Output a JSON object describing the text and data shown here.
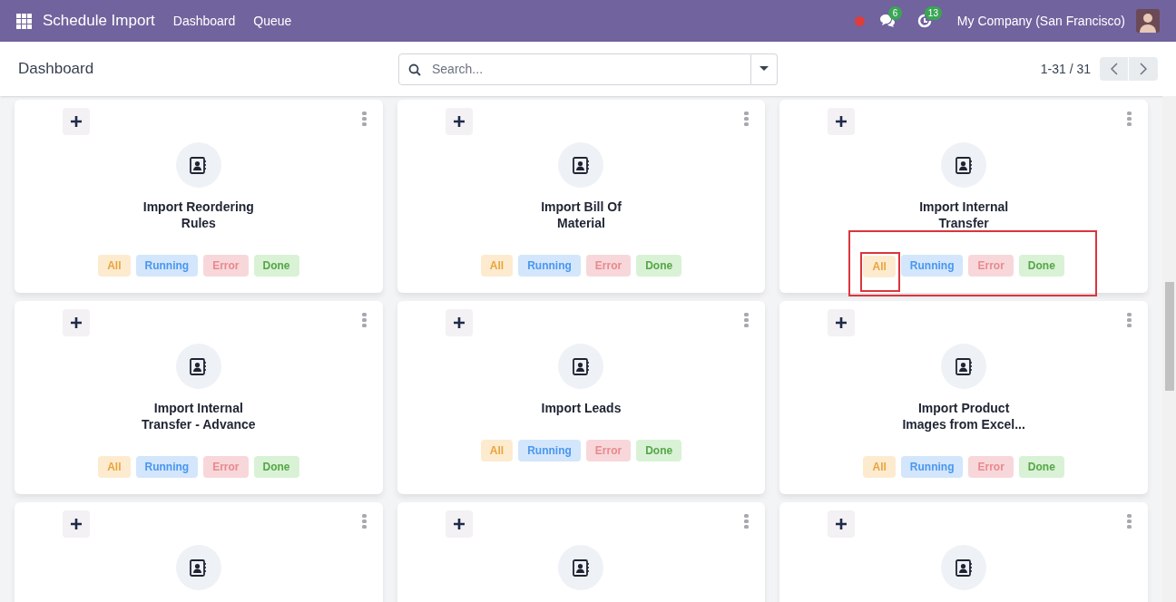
{
  "navbar": {
    "app_title": "Schedule Import",
    "menu": [
      {
        "label": "Dashboard"
      },
      {
        "label": "Queue"
      }
    ],
    "messages_count": "6",
    "activities_count": "13",
    "company": "My Company (San Francisco)"
  },
  "control_panel": {
    "breadcrumb": "Dashboard",
    "search": {
      "placeholder": "Search..."
    },
    "pager": "1-31 / 31"
  },
  "cards": [
    {
      "title": "Import Reordering Rules",
      "highlighted": false,
      "filters": [
        {
          "label": "All",
          "kind": "all",
          "highlighted": false
        },
        {
          "label": "Running",
          "kind": "running",
          "highlighted": false
        },
        {
          "label": "Error",
          "kind": "error",
          "highlighted": false
        },
        {
          "label": "Done",
          "kind": "done",
          "highlighted": false
        }
      ]
    },
    {
      "title": "Import Bill Of Material",
      "highlighted": false,
      "filters": [
        {
          "label": "All",
          "kind": "all",
          "highlighted": false
        },
        {
          "label": "Running",
          "kind": "running",
          "highlighted": false
        },
        {
          "label": "Error",
          "kind": "error",
          "highlighted": false
        },
        {
          "label": "Done",
          "kind": "done",
          "highlighted": false
        }
      ]
    },
    {
      "title": "Import Internal Transfer",
      "highlighted": true,
      "filters": [
        {
          "label": "All",
          "kind": "all",
          "highlighted": true
        },
        {
          "label": "Running",
          "kind": "running",
          "highlighted": false
        },
        {
          "label": "Error",
          "kind": "error",
          "highlighted": false
        },
        {
          "label": "Done",
          "kind": "done",
          "highlighted": false
        }
      ]
    },
    {
      "title": "Import Internal Transfer - Advance",
      "highlighted": false,
      "filters": [
        {
          "label": "All",
          "kind": "all",
          "highlighted": false
        },
        {
          "label": "Running",
          "kind": "running",
          "highlighted": false
        },
        {
          "label": "Error",
          "kind": "error",
          "highlighted": false
        },
        {
          "label": "Done",
          "kind": "done",
          "highlighted": false
        }
      ]
    },
    {
      "title": "Import Leads",
      "highlighted": false,
      "filters": [
        {
          "label": "All",
          "kind": "all",
          "highlighted": false
        },
        {
          "label": "Running",
          "kind": "running",
          "highlighted": false
        },
        {
          "label": "Error",
          "kind": "error",
          "highlighted": false
        },
        {
          "label": "Done",
          "kind": "done",
          "highlighted": false
        }
      ]
    },
    {
      "title": "Import Product Images from Excel...",
      "highlighted": false,
      "filters": [
        {
          "label": "All",
          "kind": "all",
          "highlighted": false
        },
        {
          "label": "Running",
          "kind": "running",
          "highlighted": false
        },
        {
          "label": "Error",
          "kind": "error",
          "highlighted": false
        },
        {
          "label": "Done",
          "kind": "done",
          "highlighted": false
        }
      ]
    },
    {
      "highlighted": false
    },
    {
      "highlighted": false
    },
    {
      "highlighted": false
    }
  ]
}
